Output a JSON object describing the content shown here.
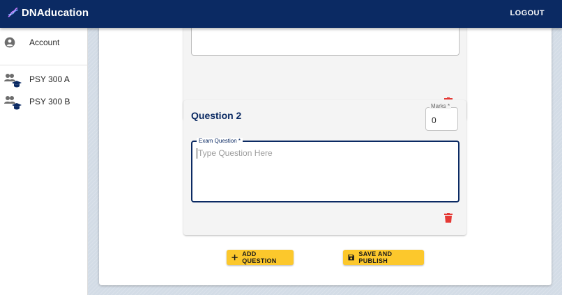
{
  "app": {
    "title": "DNAducation",
    "logout_label": "LOGOUT"
  },
  "sidebar": {
    "items": [
      {
        "label": "Account",
        "icon": "account-circle-icon"
      },
      {
        "label": "PSY 300 A",
        "icon": "class-group-icon"
      },
      {
        "label": "PSY 300 B",
        "icon": "class-group-icon"
      }
    ]
  },
  "questions": [
    {
      "title": "",
      "answer": ""
    },
    {
      "title": "Question 2",
      "marks_label": "Marks *",
      "marks_value": "0",
      "question_label": "Exam Question *",
      "question_placeholder": "Type Question Here"
    }
  ],
  "actions": {
    "add_label": "ADD QUESTION",
    "save_label": "SAVE AND PUBLISH"
  },
  "colors": {
    "brand": "#0b2a63",
    "accent": "#fcc82c",
    "danger": "#e53935"
  }
}
